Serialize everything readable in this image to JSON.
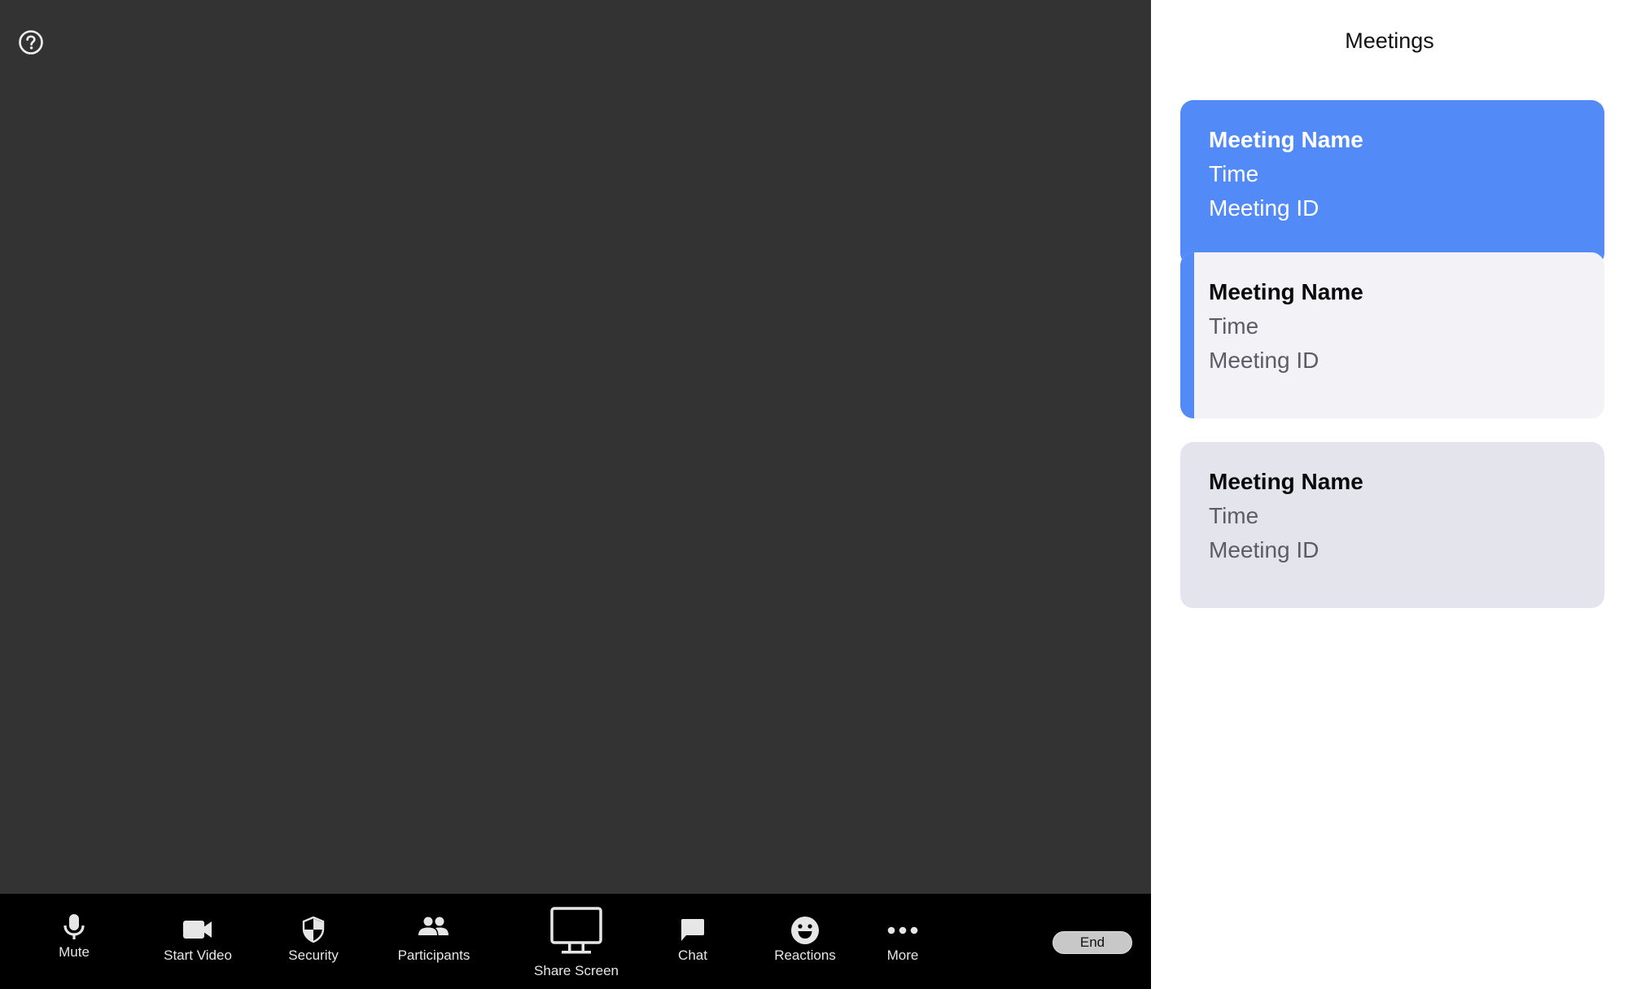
{
  "colors": {
    "video_bg": "#333333",
    "toolbar_bg": "#000000",
    "accent": "#528bf7",
    "card_hover_bg": "#f2f2f7",
    "card_bg": "#e4e4ed",
    "end_button_bg": "#c8c8c8"
  },
  "video": {
    "help_icon": "question-circle-icon"
  },
  "toolbar": {
    "items": [
      {
        "label": "Mute",
        "icon": "microphone-icon"
      },
      {
        "label": "Start Video",
        "icon": "video-camera-icon"
      },
      {
        "label": "Security",
        "icon": "shield-icon"
      },
      {
        "label": "Participants",
        "icon": "participants-icon"
      },
      {
        "label": "Share Screen",
        "icon": "monitor-icon"
      },
      {
        "label": "Chat",
        "icon": "chat-bubble-icon"
      },
      {
        "label": "Reactions",
        "icon": "smiley-icon"
      },
      {
        "label": "More",
        "icon": "more-dots-icon"
      }
    ],
    "end_label": "End"
  },
  "panel": {
    "title": "Meetings",
    "meetings": [
      {
        "name": "Meeting Name",
        "time": "Time",
        "meeting_id": "Meeting ID",
        "state": "selected"
      },
      {
        "name": "Meeting Name",
        "time": "Time",
        "meeting_id": "Meeting ID",
        "state": "hover"
      },
      {
        "name": "Meeting Name",
        "time": "Time",
        "meeting_id": "Meeting ID",
        "state": "default"
      }
    ]
  }
}
